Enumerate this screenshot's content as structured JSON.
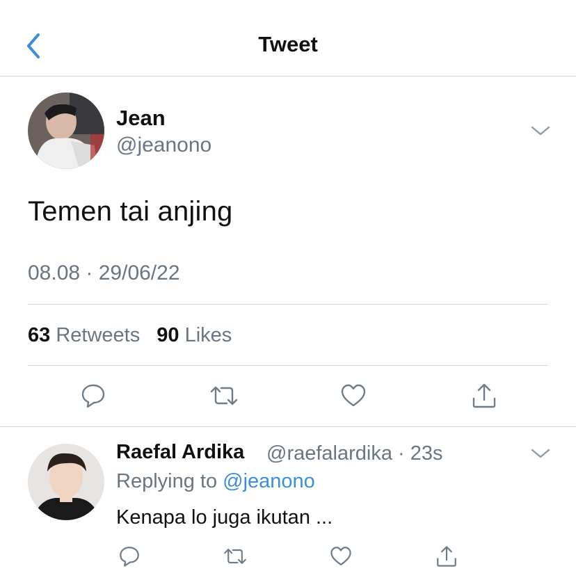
{
  "header": {
    "title": "Tweet",
    "back_icon": "chevron-left-icon",
    "accent": "#3b8fd9"
  },
  "tweet": {
    "author": {
      "name": "Jean",
      "handle": "@jeanono"
    },
    "text": "Temen tai anjing",
    "meta": "08.08 · 29/06/22",
    "stats": {
      "retweets_count": "63",
      "retweets_label": "Retweets",
      "likes_count": "90",
      "likes_label": "Likes"
    },
    "actions": [
      "reply-icon",
      "retweet-icon",
      "like-icon",
      "share-icon"
    ]
  },
  "reply": {
    "author": {
      "name": "Raefal Ardika",
      "handle_time": "@raefalardika · 23s"
    },
    "replying_prefix": "Replying to",
    "replying_to": "@jeanono",
    "text": "Kenapa lo juga ikutan ...",
    "actions": [
      "reply-icon",
      "retweet-icon",
      "like-icon",
      "share-icon"
    ]
  },
  "colors": {
    "text_primary": "#111111",
    "text_secondary": "#687684",
    "divider": "#d9d9d9",
    "link": "#3b8fd9"
  }
}
